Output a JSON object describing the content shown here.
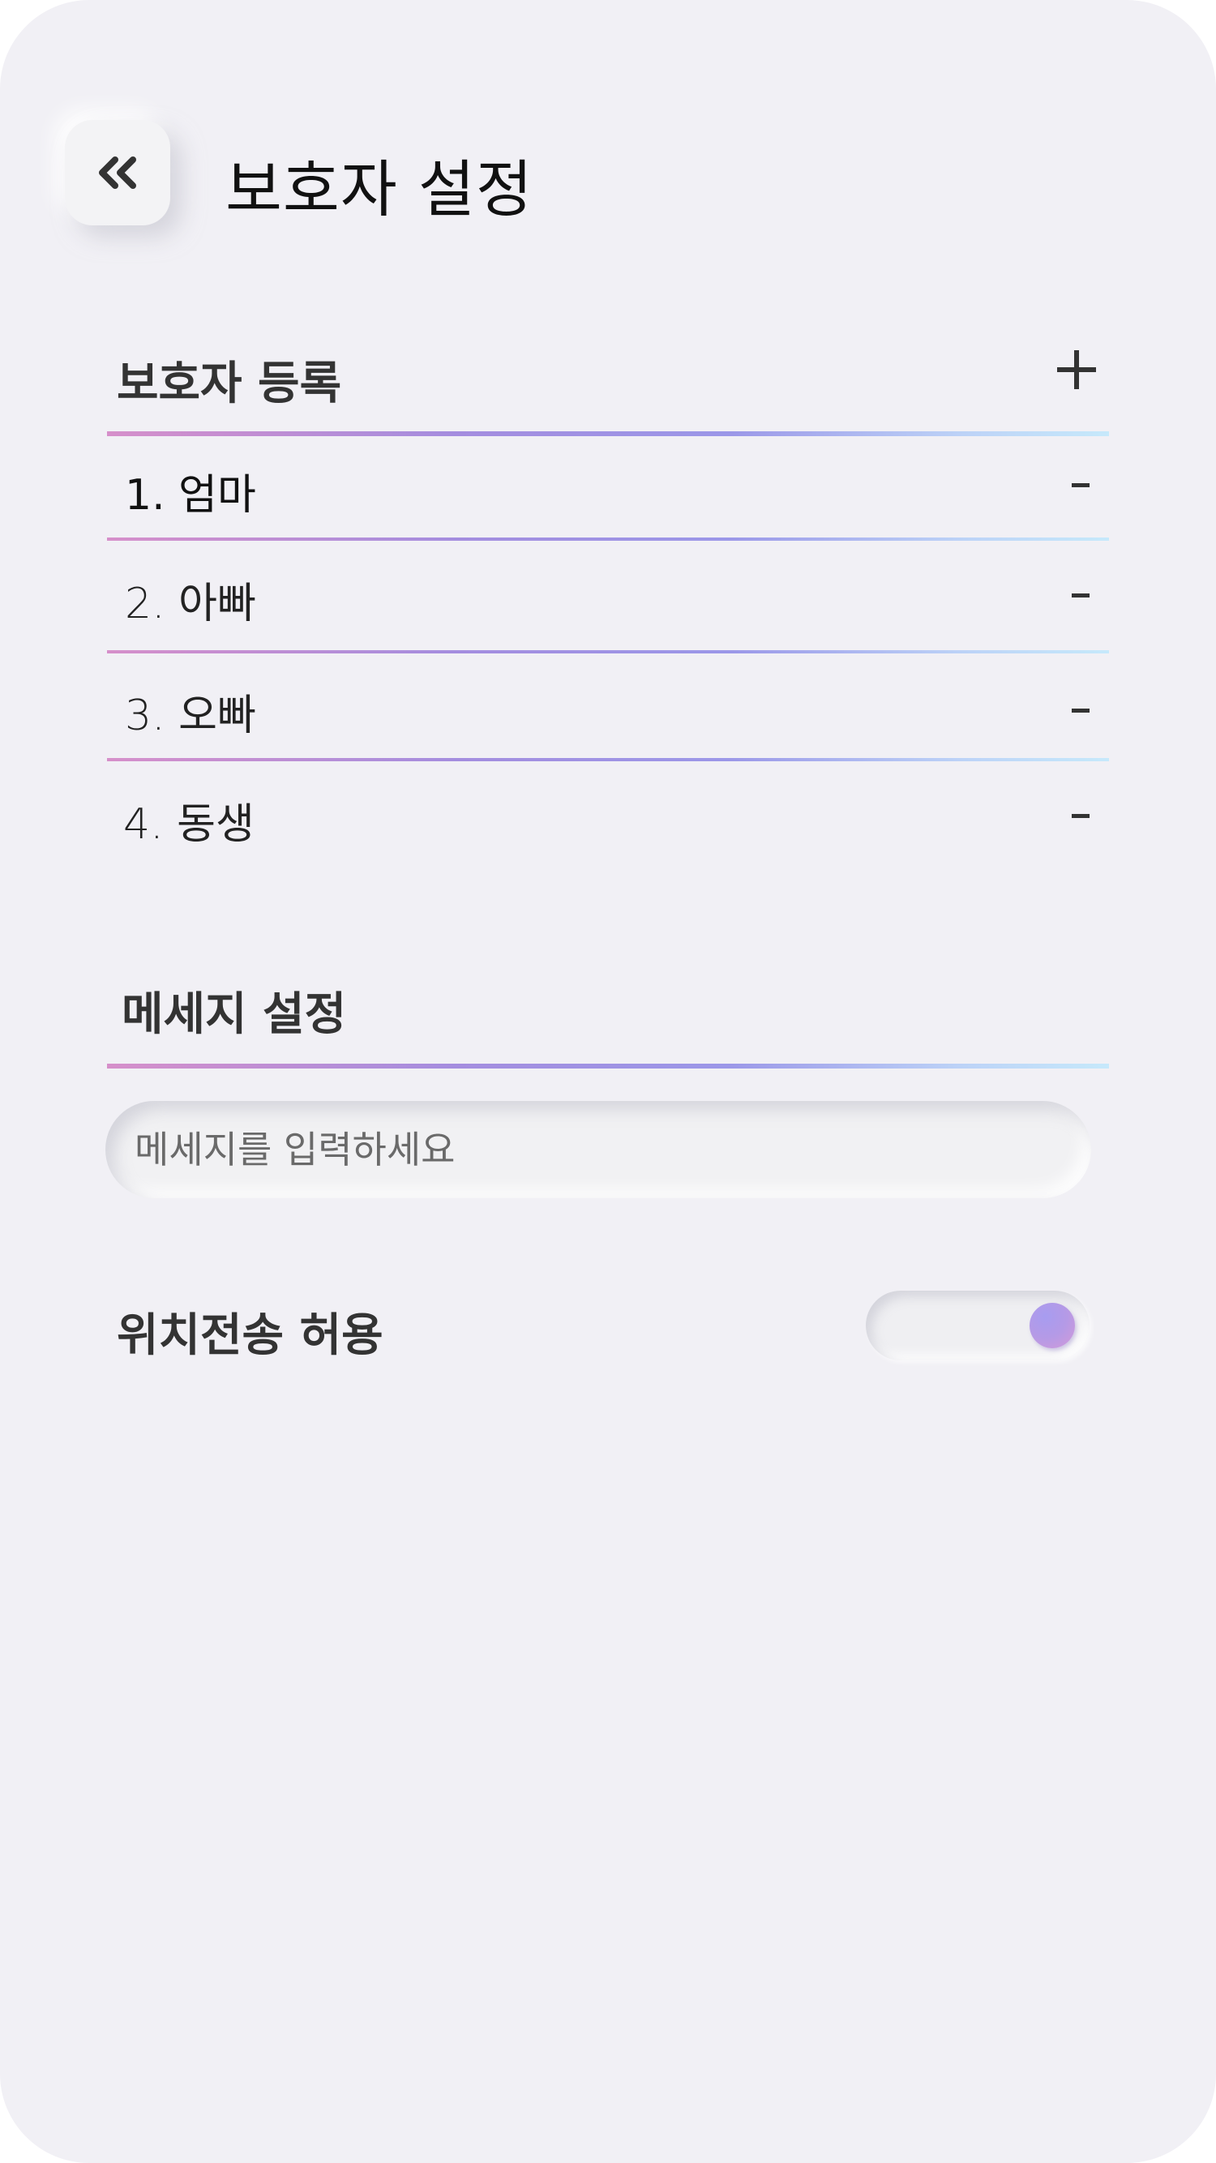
{
  "header": {
    "title": "보호자 설정",
    "back_icon": "double-chevron-left-icon"
  },
  "guardians": {
    "title": "보호자 등록",
    "add_label": "+",
    "items": [
      {
        "label": "1. 엄마",
        "remove_label": "-"
      },
      {
        "label": "2. 아빠",
        "remove_label": "-"
      },
      {
        "label": "3. 오빠",
        "remove_label": "-"
      },
      {
        "label": "4. 동생",
        "remove_label": "-"
      }
    ]
  },
  "message": {
    "title": "메세지 설정",
    "placeholder": "메세지를 입력하세요",
    "value": ""
  },
  "location": {
    "label": "위치전송 허용",
    "enabled": true
  },
  "colors": {
    "background": "#f1f0f5",
    "gradient": [
      "#d68fca",
      "#a48ddf",
      "#9b97e8",
      "#c6e9fb"
    ],
    "toggle_knob": "#b59ae6"
  }
}
